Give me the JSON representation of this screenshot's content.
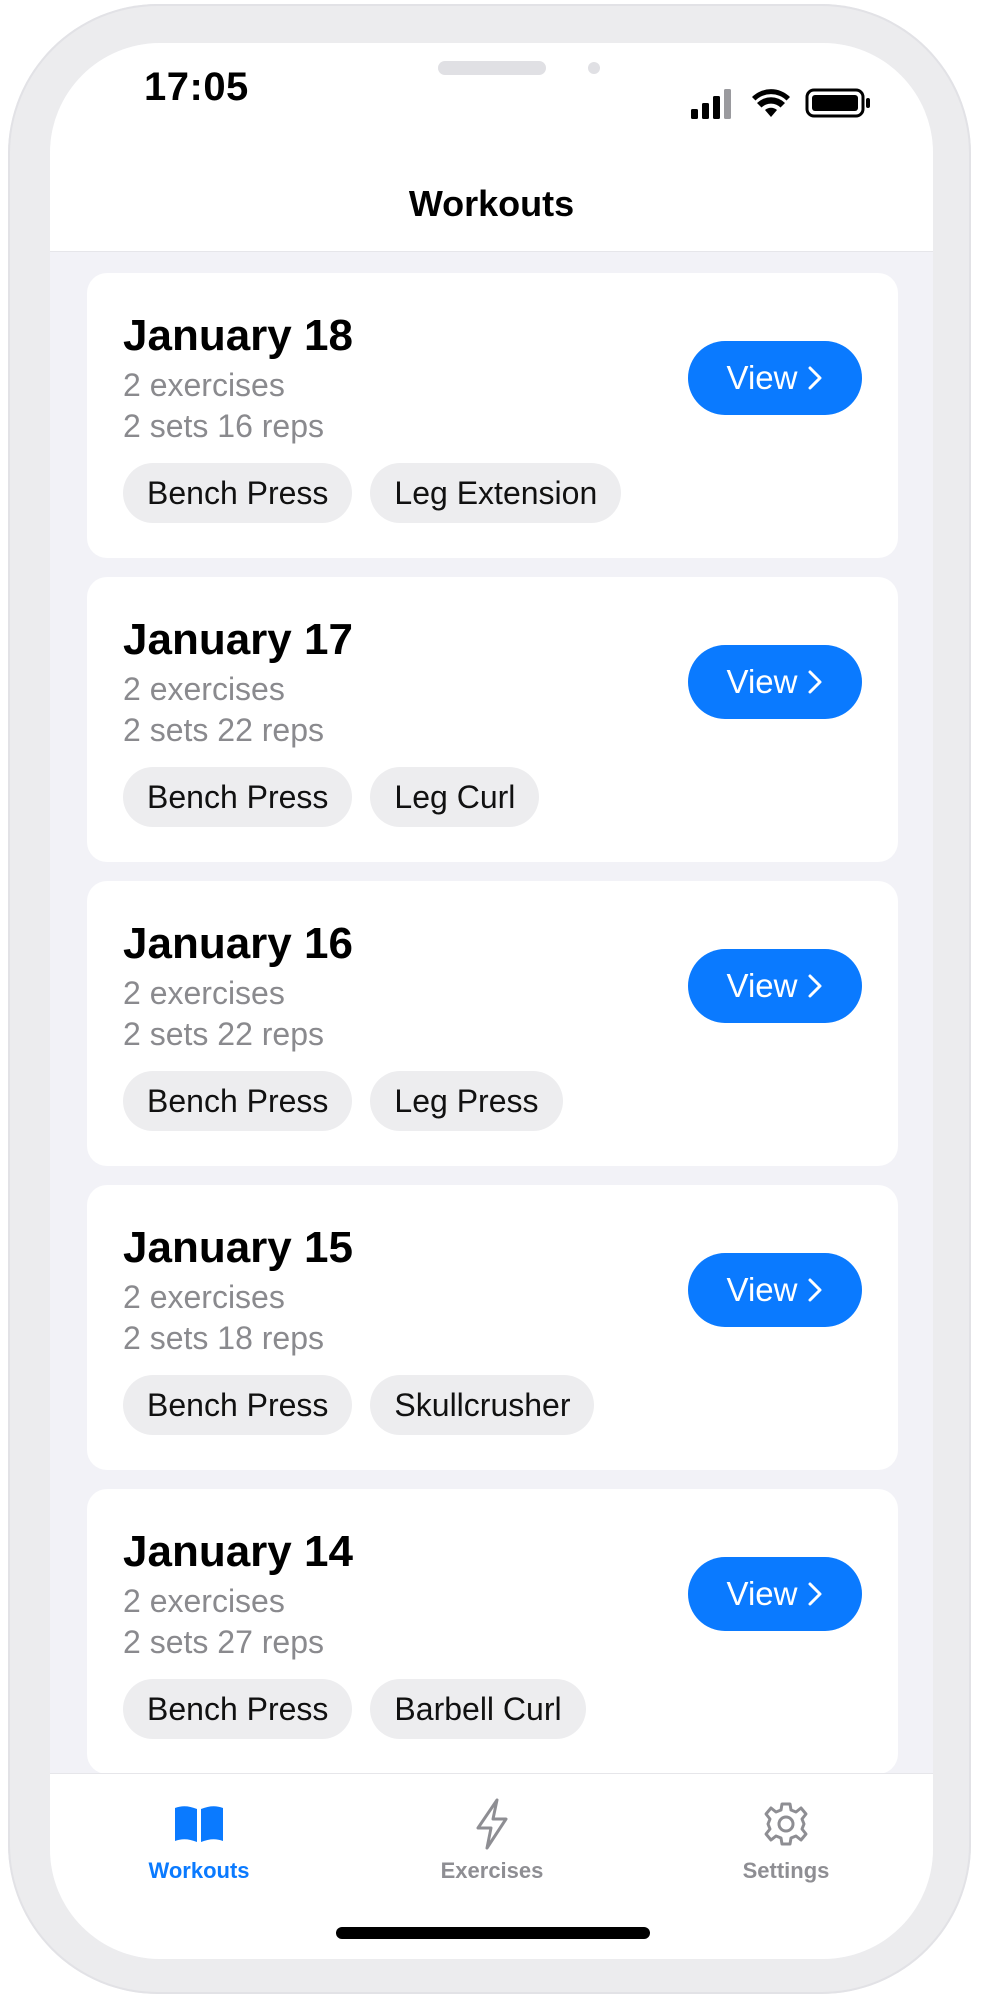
{
  "status_bar": {
    "time": "17:05"
  },
  "nav": {
    "title": "Workouts"
  },
  "accent_color": "#0a7aff",
  "workouts": [
    {
      "date": "January 18",
      "exercises": "2 exercises",
      "summary": "2 sets 16 reps",
      "tags": [
        "Bench Press",
        "Leg Extension"
      ],
      "button": "View"
    },
    {
      "date": "January 17",
      "exercises": "2 exercises",
      "summary": "2 sets 22 reps",
      "tags": [
        "Bench Press",
        "Leg Curl"
      ],
      "button": "View"
    },
    {
      "date": "January 16",
      "exercises": "2 exercises",
      "summary": "2 sets 22 reps",
      "tags": [
        "Bench Press",
        "Leg Press"
      ],
      "button": "View"
    },
    {
      "date": "January 15",
      "exercises": "2 exercises",
      "summary": "2 sets 18 reps",
      "tags": [
        "Bench Press",
        "Skullcrusher"
      ],
      "button": "View"
    },
    {
      "date": "January 14",
      "exercises": "2 exercises",
      "summary": "2 sets 27 reps",
      "tags": [
        "Bench Press",
        "Barbell Curl"
      ],
      "button": "View"
    }
  ],
  "tab_bar": {
    "items": [
      {
        "label": "Workouts",
        "icon": "book-icon",
        "active": true,
        "color": "#0a7aff"
      },
      {
        "label": "Exercises",
        "icon": "bolt-icon",
        "active": false,
        "color": "#8e8e93"
      },
      {
        "label": "Settings",
        "icon": "gear-icon",
        "active": false,
        "color": "#8e8e93"
      }
    ]
  }
}
